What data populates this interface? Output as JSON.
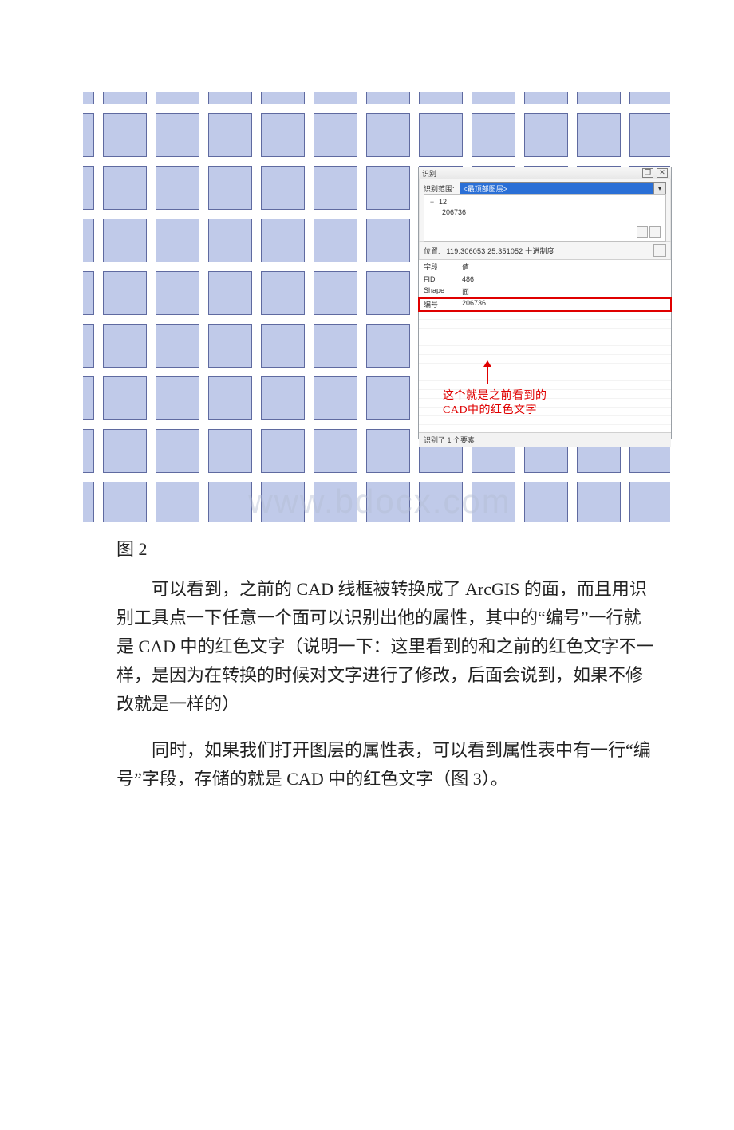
{
  "figure": {
    "identify_panel": {
      "title": "识别",
      "scope_label": "识别范围:",
      "scope_value": "<最顶部图层>",
      "tree_root": "12",
      "tree_child": "206736",
      "location_label": "位置:",
      "location_value": "119.306053 25.351052 十进制度",
      "field_header_key": "字段",
      "field_header_val": "值",
      "rows": {
        "fid_key": "FID",
        "fid_val": "486",
        "shape_key": "Shape",
        "shape_val": "面",
        "id_key": "编号",
        "id_val": "206736"
      },
      "status": "识别了 1 个要素"
    },
    "annotation_line1": "这个就是之前看到的",
    "annotation_line2": "CAD中的红色文字",
    "watermark": "www.bdocx.com"
  },
  "caption": "图 2",
  "paragraphs": {
    "p1_a": "可以看到，之前的 ",
    "p1_b": "CAD",
    "p1_c": " 线框被转换成了 ",
    "p1_d": "ArcGIS",
    "p1_e": " 的面，而且用识别工具点一下任意一个面可以识别出他的属性，其中的“编号”一行就是 ",
    "p1_f": "CAD",
    "p1_g": " 中的红色文字（说明一下：这里看到的和之前的红色文字不一样，是因为在转换的时候对文字进行了修改，后面会说到，如果不修改就是一样的）",
    "p2_a": "同时，如果我们打开图层的属性表，可以看到属性表中有一行“编号”字段，存储的就是 ",
    "p2_b": "CAD",
    "p2_c": " 中的红色文字（图 3）。"
  }
}
